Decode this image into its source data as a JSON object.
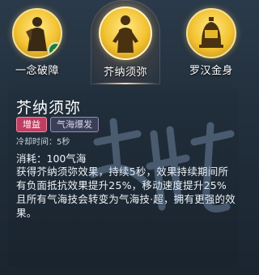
{
  "tabs": [
    {
      "label": "一念破障",
      "icon": "warrior-icon",
      "completed": true
    },
    {
      "label": "芥纳须弥",
      "icon": "monk-icon",
      "active": true
    },
    {
      "label": "罗汉金身",
      "icon": "bell-icon"
    }
  ],
  "skill": {
    "title": "芥纳须弥",
    "tags": [
      "增益",
      "气海爆发"
    ],
    "cooldown": "冷却时间：5秒",
    "cost": "消耗：100气海",
    "description": "获得芥纳须弥效果，持续5秒，效果持续期间所有负面抵抗效果提升25%，移动速度提升25%且所有气海技会转变为气海技·超，拥有更强的效果。"
  },
  "colors": {
    "accent_gold": "#f3c230",
    "tag_buff": "#c13d60",
    "tag_burst": "#3a3f56"
  }
}
